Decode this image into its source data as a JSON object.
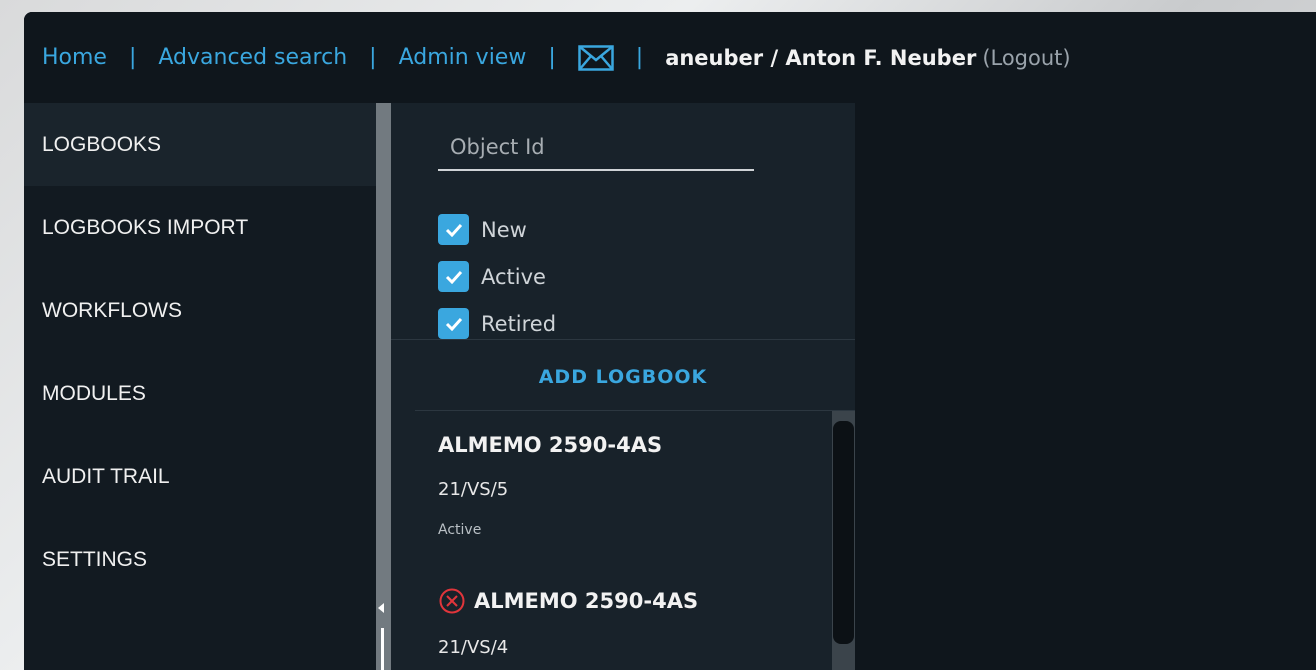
{
  "header": {
    "links": {
      "home": "Home",
      "advanced_search": "Advanced search",
      "admin_view": "Admin view"
    },
    "separator": "|",
    "mail_icon": "mail-icon",
    "user_display": "aneuber / Anton F. Neuber",
    "logout": "(Logout)"
  },
  "sidebar": {
    "items": [
      {
        "label": "LOGBOOKS",
        "active": true
      },
      {
        "label": "LOGBOOKS IMPORT"
      },
      {
        "label": "WORKFLOWS"
      },
      {
        "label": "MODULES"
      },
      {
        "label": "AUDIT TRAIL"
      },
      {
        "label": "SETTINGS"
      }
    ]
  },
  "filter": {
    "search_placeholder": "Object Id",
    "search_value": "",
    "checkboxes": [
      {
        "label": "New",
        "checked": true
      },
      {
        "label": "Active",
        "checked": true
      },
      {
        "label": "Retired",
        "checked": true
      }
    ],
    "add_button": "ADD LOGBOOK"
  },
  "results": [
    {
      "title": "ALMEMO 2590-4AS",
      "code": "21/VS/5",
      "status": "Active",
      "error": false
    },
    {
      "title": "ALMEMO 2590-4AS",
      "code": "21/VS/4",
      "error": true
    }
  ],
  "colors": {
    "accent": "#3aa7df",
    "error": "#e0353b",
    "background": "#0f161c",
    "panel": "#18222a"
  }
}
